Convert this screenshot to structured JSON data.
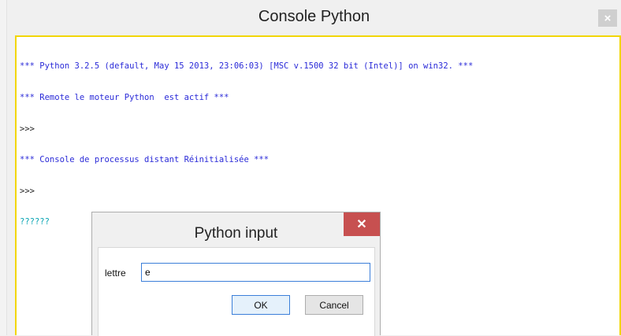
{
  "window": {
    "title": "Console Python",
    "close_glyph": "×"
  },
  "console": {
    "lines": [
      {
        "text": "*** Python 3.2.5 (default, May 15 2013, 23:06:03) [MSC v.1500 32 bit (Intel)] on win32. ***",
        "kind": "banner"
      },
      {
        "text": "*** Remote le moteur Python  est actif ***",
        "kind": "banner"
      },
      {
        "text": ">>>",
        "kind": "prompt"
      },
      {
        "text": "*** Console de processus distant Réinitialisée ***",
        "kind": "banner"
      },
      {
        "text": ">>>",
        "kind": "prompt"
      },
      {
        "text": "??????",
        "kind": "input"
      }
    ]
  },
  "dialog": {
    "title": "Python input",
    "close_glyph": "✕",
    "field_label": "lettre",
    "field_value": "e",
    "ok_label": "OK",
    "cancel_label": "Cancel"
  },
  "colors": {
    "banner_text": "#2a2ad8",
    "input_text": "#0aa5b4",
    "console_border": "#f2d600",
    "dialog_close": "#c75050"
  }
}
